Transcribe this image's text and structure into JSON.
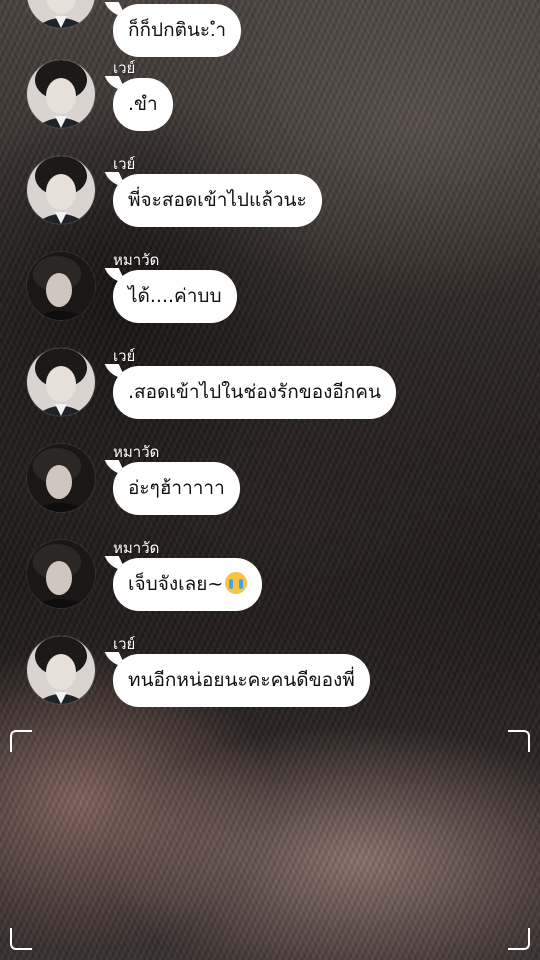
{
  "messages": [
    {
      "avatar": "avatar-way",
      "name": "",
      "text": "ก็ก็ปกตินะ.ำ"
    },
    {
      "avatar": "avatar-way",
      "name": "เวย์",
      "text": ".ขำ"
    },
    {
      "avatar": "avatar-way",
      "name": "เวย์",
      "text": "พี่จะสอดเข้าไปแล้วนะ"
    },
    {
      "avatar": "avatar-mawat",
      "name": "หมาวัด",
      "text": "ได้....ค่าบบ"
    },
    {
      "avatar": "avatar-way",
      "name": "เวย์",
      "text": ".สอดเข้าไปในช่องรักของอีกคน"
    },
    {
      "avatar": "avatar-mawat",
      "name": "หมาวัด",
      "text": "อ่ะๆฮ้าาาาา"
    },
    {
      "avatar": "avatar-mawat",
      "name": "หมาวัด",
      "text": "เจ็บจังเลย~",
      "emoji": "loudly-crying-face-icon"
    },
    {
      "avatar": "avatar-way",
      "name": "เวย์",
      "text": "ทนอีกหน่อยนะคะคนดีของพี่"
    }
  ],
  "colors": {
    "bubble": "#ffffff",
    "text": "#111111",
    "name": "#ffffff"
  }
}
